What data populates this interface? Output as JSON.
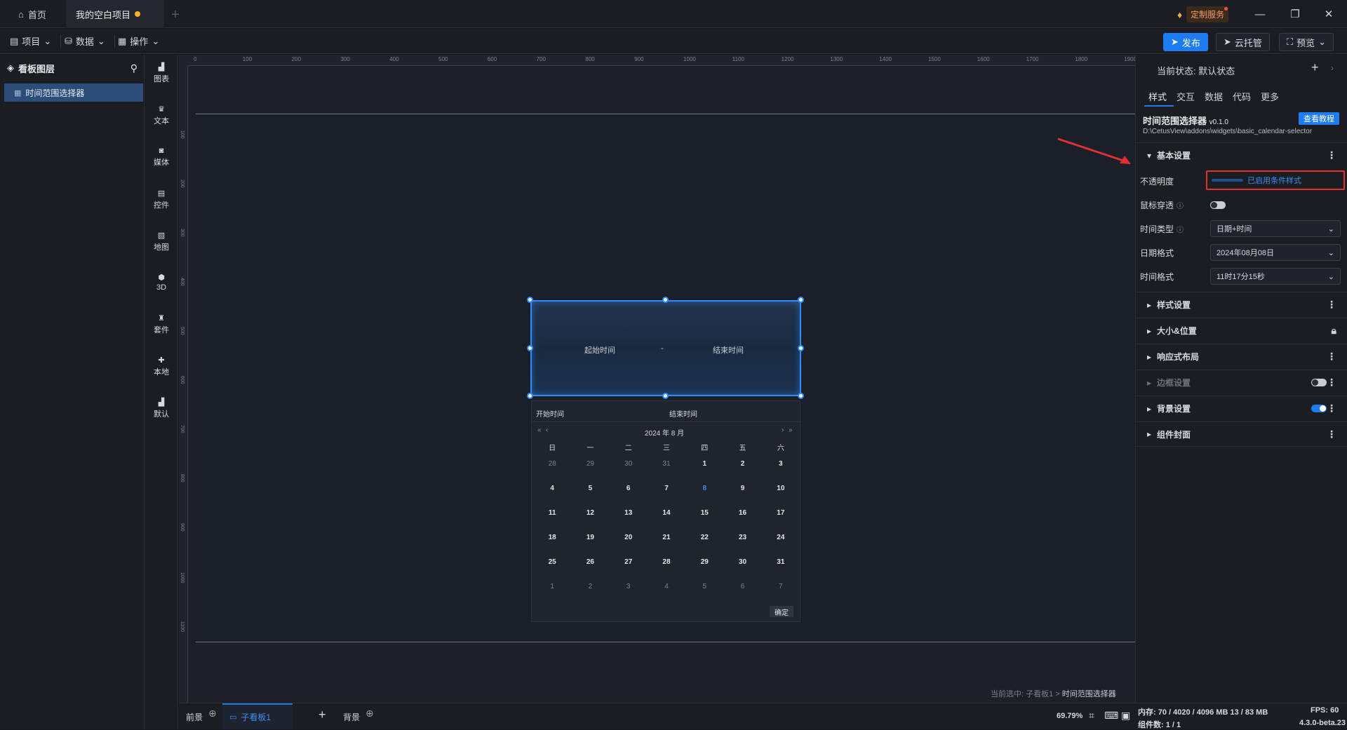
{
  "titlebar": {
    "home_tab": "首页",
    "project_tab": "我的空白项目",
    "custom_service": "定制服务"
  },
  "menubar": {
    "project": "项目",
    "data": "数据",
    "operate": "操作",
    "publish": "发布",
    "cloud_host": "云托管",
    "preview": "预览"
  },
  "layers": {
    "title": "看板图层",
    "items": [
      "时间范围选择器"
    ]
  },
  "tools": [
    "图表",
    "文本",
    "媒体",
    "控件",
    "地图",
    "3D",
    "套件",
    "本地",
    "默认"
  ],
  "ruler": {
    "h_ticks": [
      "0",
      "100",
      "200",
      "300",
      "400",
      "500",
      "600",
      "700",
      "800",
      "900",
      "1000",
      "1100",
      "1200",
      "1300",
      "1400",
      "1500",
      "1600",
      "1700",
      "1800",
      "1900"
    ],
    "v_ticks": [
      "100",
      "200",
      "300",
      "400",
      "500",
      "600",
      "700",
      "800",
      "900",
      "1000",
      "1100"
    ]
  },
  "widget": {
    "start": "起始时间",
    "dash": "-",
    "end": "结束时间"
  },
  "calendar": {
    "start_label": "开始时间",
    "end_label": "结束时间",
    "month": "2024 年 8 月",
    "weekdays": [
      "日",
      "一",
      "二",
      "三",
      "四",
      "五",
      "六"
    ],
    "weeks": [
      [
        "28",
        "29",
        "30",
        "31",
        "1",
        "2",
        "3"
      ],
      [
        "4",
        "5",
        "6",
        "7",
        "8",
        "9",
        "10"
      ],
      [
        "11",
        "12",
        "13",
        "14",
        "15",
        "16",
        "17"
      ],
      [
        "18",
        "19",
        "20",
        "21",
        "22",
        "23",
        "24"
      ],
      [
        "25",
        "26",
        "27",
        "28",
        "29",
        "30",
        "31"
      ],
      [
        "1",
        "2",
        "3",
        "4",
        "5",
        "6",
        "7"
      ]
    ],
    "confirm": "确定",
    "today_color": "#3d8ef0"
  },
  "bottombar": {
    "foreground": "前景",
    "subboard": "子看板1",
    "background": "背景",
    "zoom": "69.79%",
    "breadcrumb_prefix": "当前选中: 子看板1 >",
    "breadcrumb_target": "时间范围选择器"
  },
  "right": {
    "state_label": "当前状态:",
    "state_value": "默认状态",
    "tabs": [
      "样式",
      "交互",
      "数据",
      "代码",
      "更多"
    ],
    "component_name": "时间范围选择器",
    "version": "v0.1.0",
    "tutorial": "查看教程",
    "path": "D:\\CetusView\\addons\\widgets\\basic_calendar-selector",
    "basic_settings": "基本设置",
    "opacity_label": "不透明度",
    "opacity_value": "已启用条件样式",
    "mouse_through": "鼠标穿透",
    "time_type_label": "时间类型",
    "time_type_value": "日期+时间",
    "date_format_label": "日期格式",
    "date_format_value": "2024年08月08日",
    "time_format_label": "时间格式",
    "time_format_value": "11时17分15秒",
    "sections": [
      "样式设置",
      "大小&位置",
      "响应式布局",
      "边框设置",
      "背景设置",
      "组件封面"
    ]
  },
  "status": {
    "memory_label": "内存:",
    "memory_value": "70 / 4020 / 4096 MB",
    "memory_extra": "13 / 83 MB",
    "fps": "FPS: 60",
    "components": "组件数: 1 / 1",
    "version": "4.3.0-beta.23"
  },
  "colors": {
    "accent": "#1e7cf2",
    "selection": "#2d8cff",
    "highlight_box": "#e03131",
    "arrow": "#e03131"
  }
}
